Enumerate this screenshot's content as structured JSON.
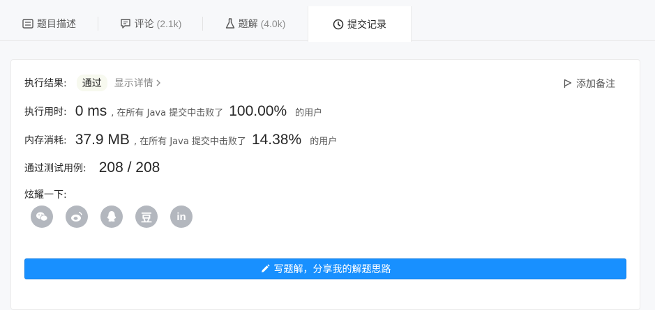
{
  "tabs": [
    {
      "label": "题目描述",
      "count": "",
      "icon": "description-icon"
    },
    {
      "label": "评论",
      "count": "(2.1k)",
      "icon": "comment-icon"
    },
    {
      "label": "题解",
      "count": "(4.0k)",
      "icon": "flask-icon"
    },
    {
      "label": "提交记录",
      "count": "",
      "icon": "clock-icon",
      "active": true
    }
  ],
  "result": {
    "label": "执行结果:",
    "status": "通过",
    "detail_link": "显示详情",
    "add_note": "添加备注"
  },
  "runtime": {
    "label": "执行用时:",
    "value": "0 ms",
    "middle": ", 在所有 Java 提交中击败了",
    "percent": "100.00",
    "percent_sign": "%",
    "suffix": "的用户"
  },
  "memory": {
    "label": "内存消耗:",
    "value": "37.9 MB",
    "middle": ", 在所有 Java 提交中击败了",
    "percent": "14.38",
    "percent_sign": "%",
    "suffix": "的用户"
  },
  "testcases": {
    "label": "通过测试用例:",
    "value": "208 / 208"
  },
  "share": {
    "label": "炫耀一下:",
    "icons": [
      "wechat-icon",
      "weibo-icon",
      "qq-icon",
      "douban-icon",
      "linkedin-icon"
    ],
    "douban_glyph": "豆",
    "linkedin_glyph": "in"
  },
  "write_solution": {
    "label": "写题解，分享我的解题思路"
  },
  "colors": {
    "accent": "#1890ff",
    "success_badge_bg": "#f7f9ef",
    "share_icon_bg": "#b3b7be"
  }
}
